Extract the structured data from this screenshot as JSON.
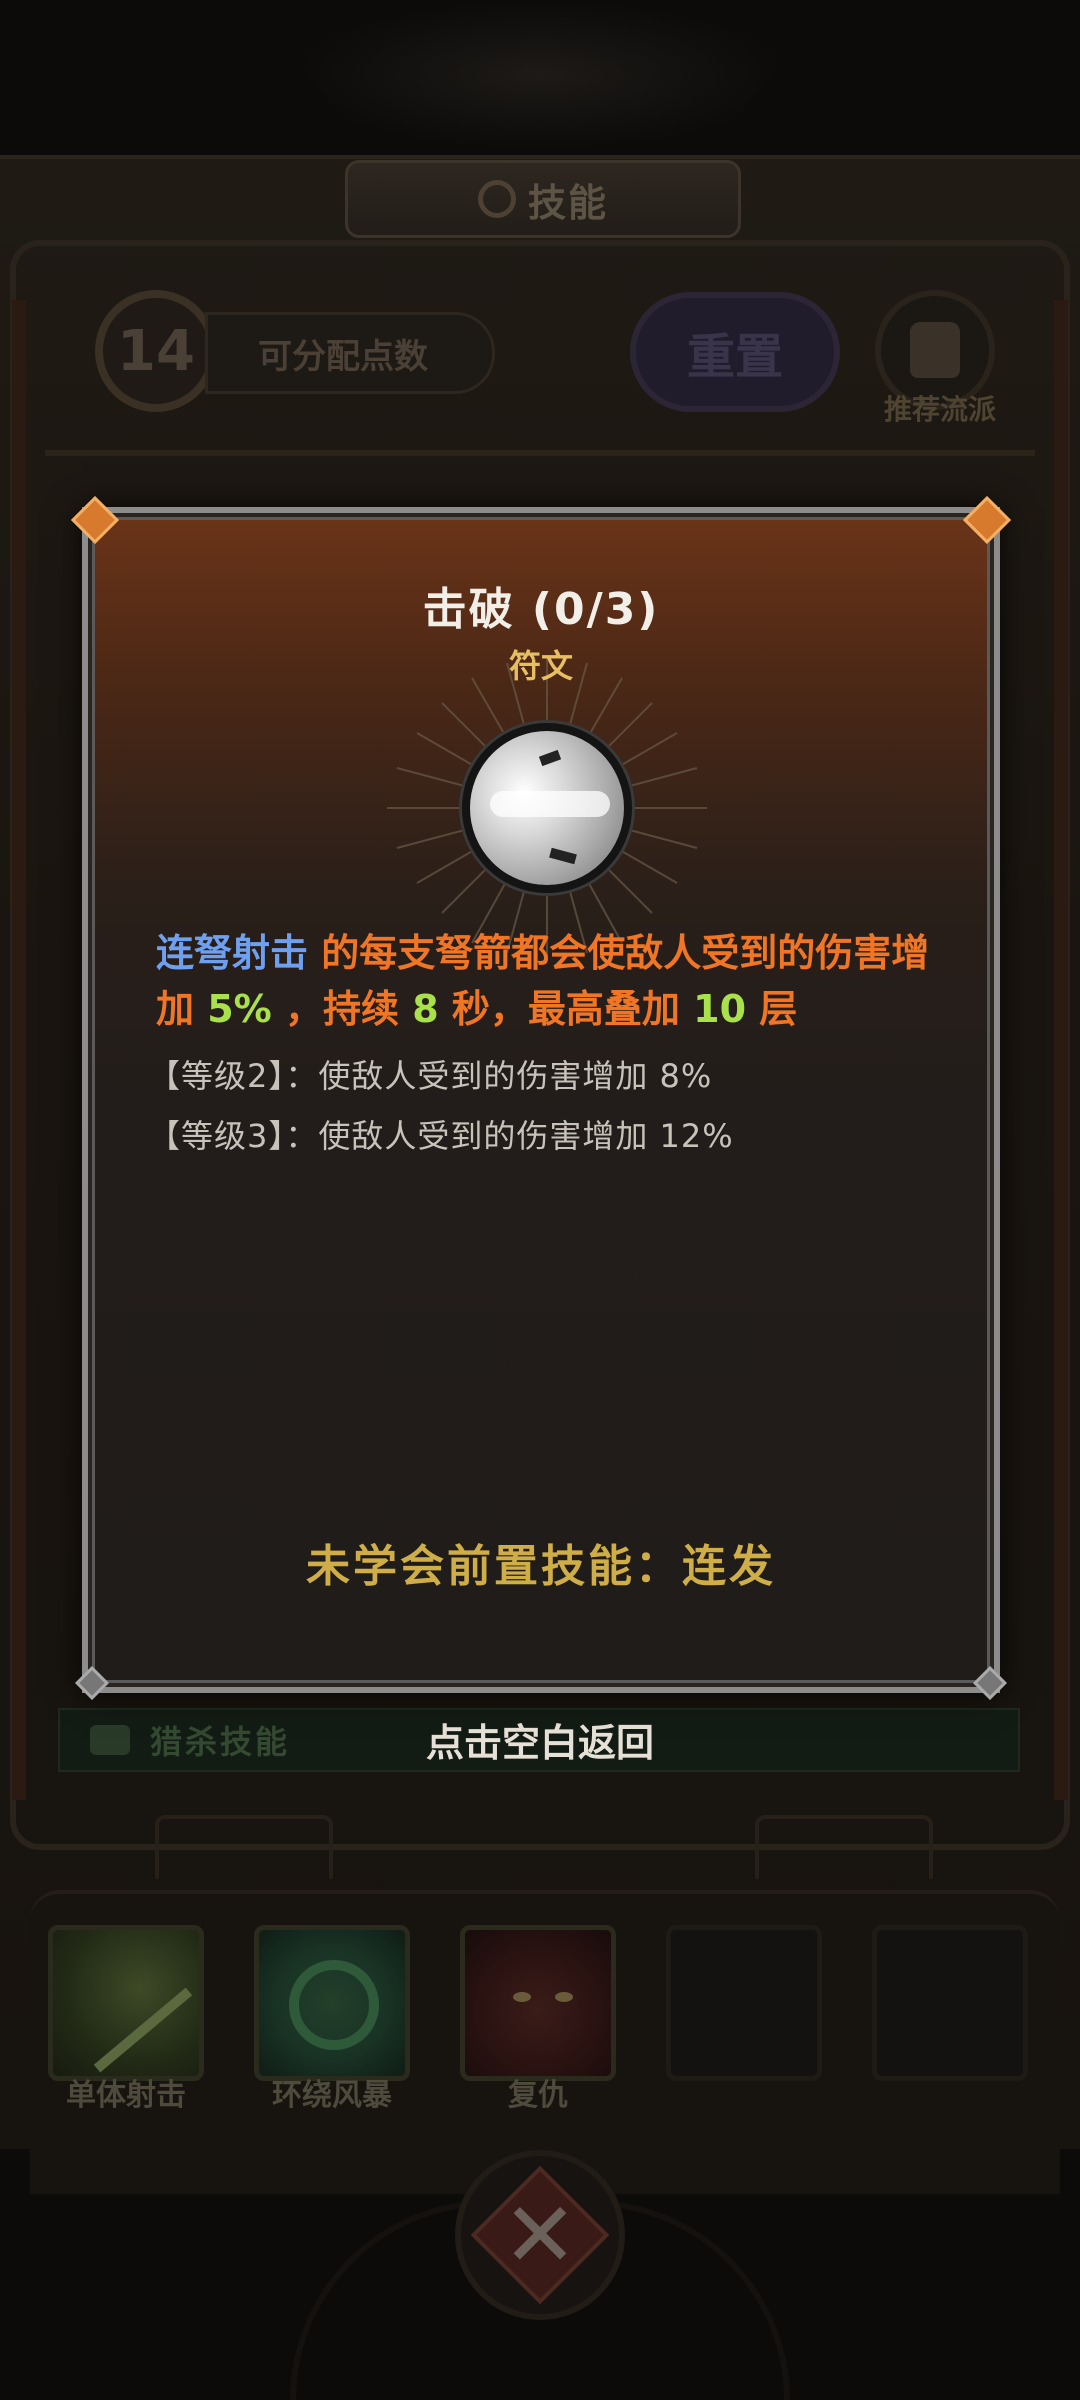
{
  "background": {
    "header_title": "技能",
    "points_count": "14",
    "points_label": "可分配点数",
    "reset_label": "重置",
    "recommend_label": "推荐流派",
    "banner_label": "猎杀技能",
    "skills": [
      {
        "label": "单体射击"
      },
      {
        "label": "环绕风暴"
      },
      {
        "label": "复仇"
      }
    ]
  },
  "modal": {
    "title": "击破 (0/3)",
    "type": "符文",
    "description": {
      "skill_ref": "连弩射击",
      "part1": " 的每支弩箭都会使敌人受到的伤害增加 ",
      "value1": "5%",
      "part2": " ，持续 ",
      "value2": "8",
      "part3": " 秒，最高叠加 ",
      "value3": "10",
      "part4": " 层"
    },
    "levels": [
      {
        "text": "【等级2】：使敌人受到的伤害增加 8%"
      },
      {
        "text": "【等级3】：使敌人受到的伤害增加 12%"
      }
    ],
    "prerequisite": "未学会前置技能：连发"
  },
  "return_hint": "点击空白返回"
}
